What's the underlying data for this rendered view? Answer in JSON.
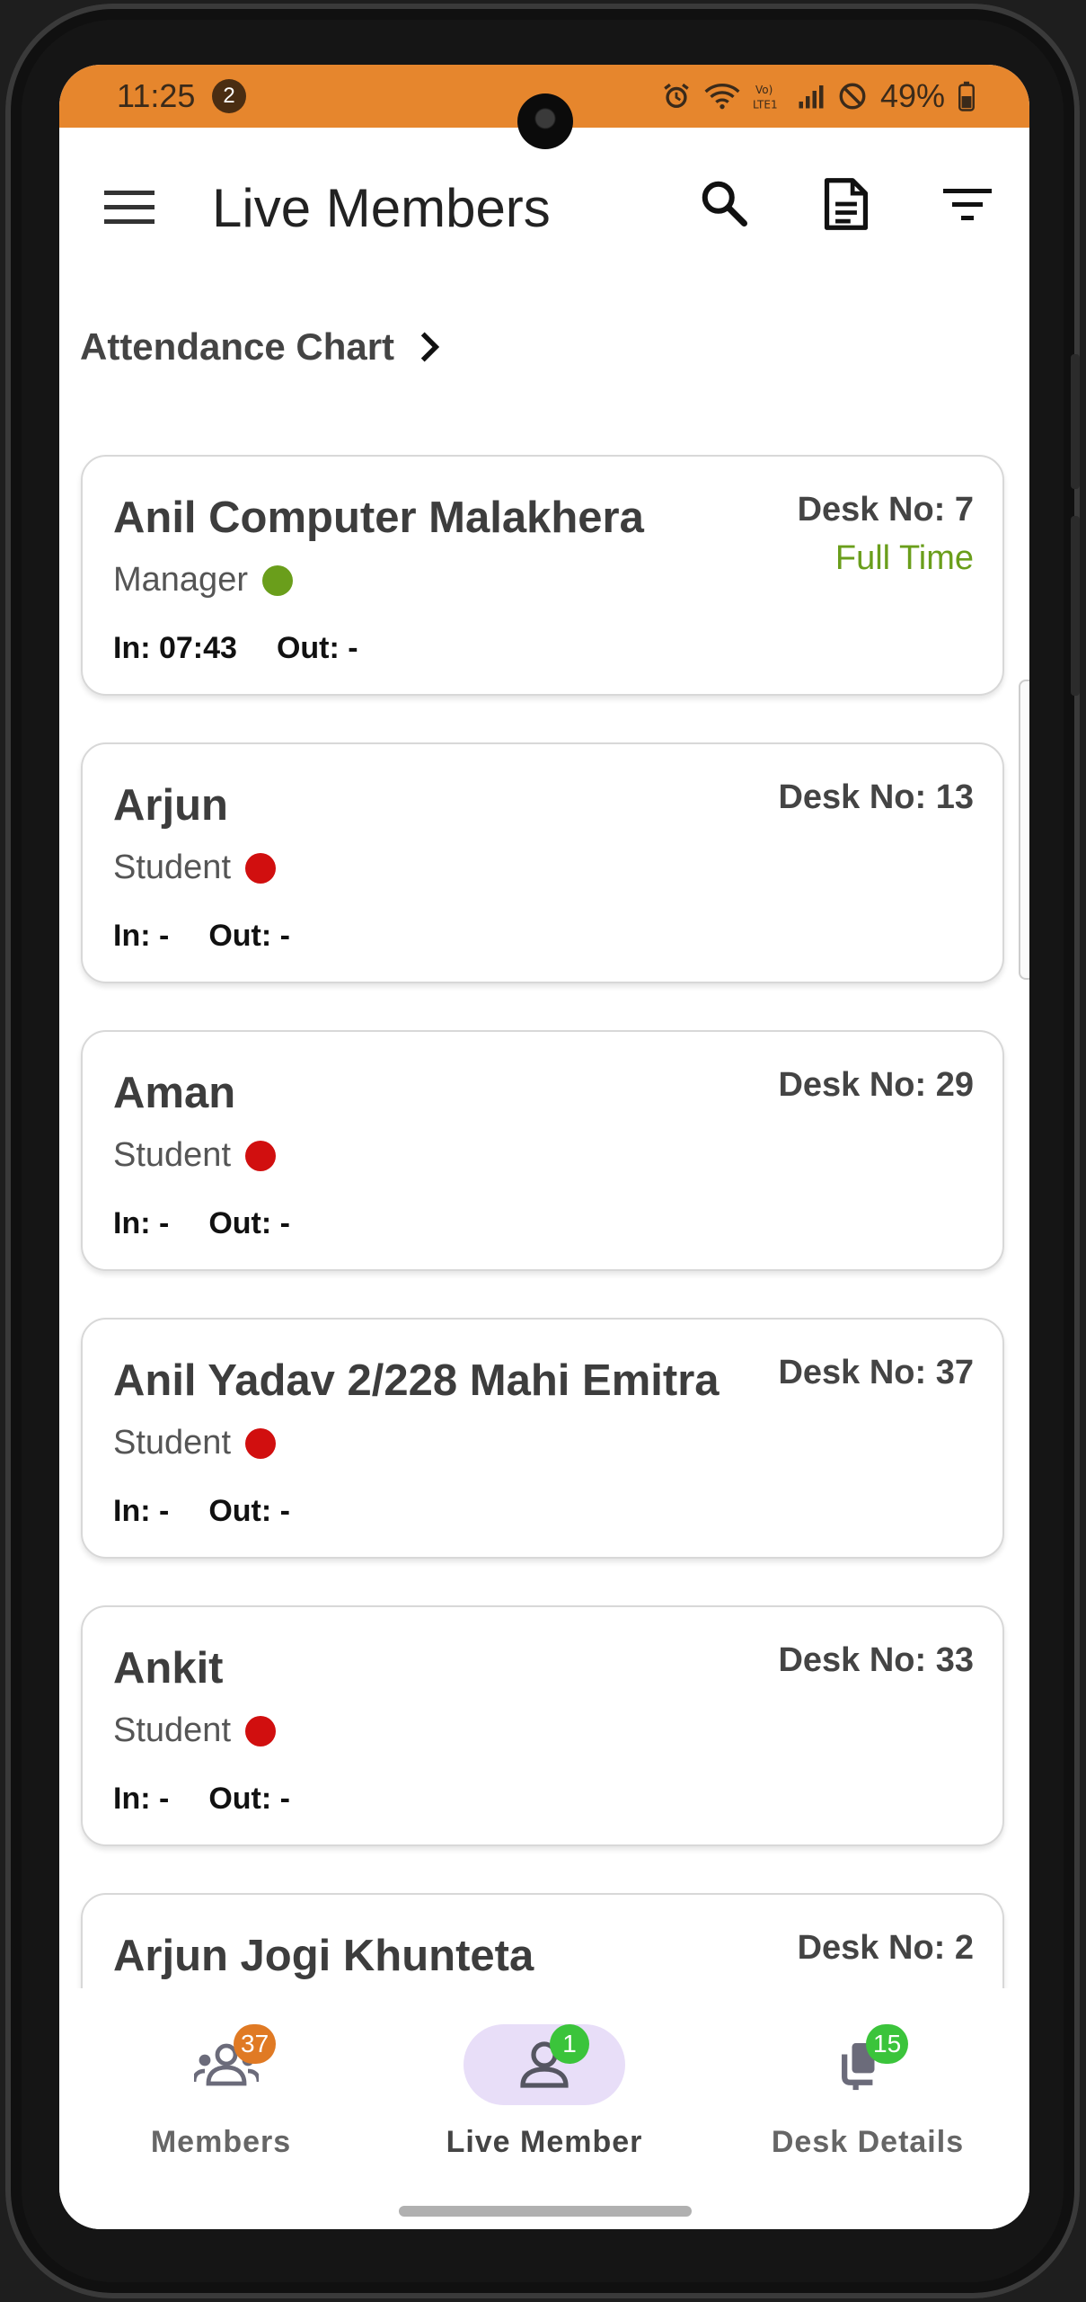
{
  "status_bar": {
    "time": "11:25",
    "notification_count": "2",
    "battery": "49%"
  },
  "app_bar": {
    "title": "Live Members"
  },
  "attendance_link": {
    "label": "Attendance Chart"
  },
  "members": [
    {
      "name": "Anil Computer Malakhera",
      "role": "Manager",
      "status_color": "#6a9e1b",
      "in": "In: 07:43",
      "out": "Out: -",
      "desk": "Desk No: 7",
      "plan": "Full Time"
    },
    {
      "name": "Arjun",
      "role": "Student",
      "status_color": "#d10f0f",
      "in": "In: -",
      "out": "Out: -",
      "desk": "Desk No: 13",
      "plan": ""
    },
    {
      "name": "Aman",
      "role": "Student",
      "status_color": "#d10f0f",
      "in": "In: -",
      "out": "Out: -",
      "desk": "Desk No: 29",
      "plan": ""
    },
    {
      "name": "Anil Yadav 2/228 Mahi Emitra",
      "role": "Student",
      "status_color": "#d10f0f",
      "in": "In: -",
      "out": "Out: -",
      "desk": "Desk No: 37",
      "plan": ""
    },
    {
      "name": "Ankit",
      "role": "Student",
      "status_color": "#d10f0f",
      "in": "In: -",
      "out": "Out: -",
      "desk": "Desk No: 33",
      "plan": ""
    },
    {
      "name": "Arjun Jogi Khunteta",
      "role": "",
      "status_color": "",
      "in": "",
      "out": "",
      "desk": "Desk No: 2",
      "plan": ""
    }
  ],
  "bottom_nav": {
    "items": [
      {
        "label": "Members",
        "badge": "37",
        "badge_color": "#E07A24",
        "icon": "members-icon"
      },
      {
        "label": "Live Member",
        "badge": "1",
        "badge_color": "#3BC43B",
        "icon": "live-member-icon"
      },
      {
        "label": "Desk Details",
        "badge": "15",
        "badge_color": "#3BC43B",
        "icon": "desk-details-icon"
      }
    ]
  },
  "colors": {
    "status_bar": "#E6862D",
    "active_nav": "#E8DEF8",
    "full_time": "#6a9e1b",
    "online": "#6a9e1b",
    "offline": "#d10f0f"
  }
}
